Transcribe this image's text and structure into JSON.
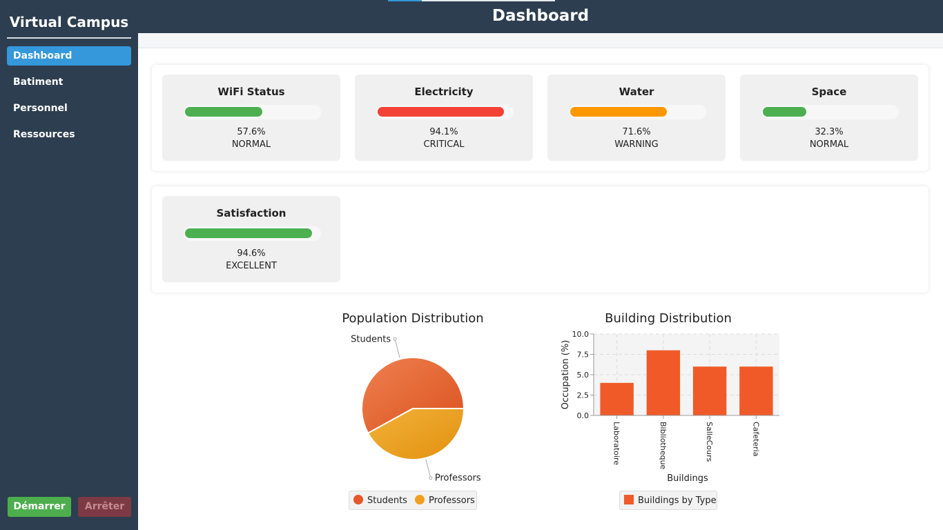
{
  "app": {
    "title": "Virtual Campus"
  },
  "header": {
    "title": "Dashboard"
  },
  "sidebar": {
    "items": [
      {
        "label": "Dashboard",
        "active": true
      },
      {
        "label": "Batiment",
        "active": false
      },
      {
        "label": "Personnel",
        "active": false
      },
      {
        "label": "Ressources",
        "active": false
      }
    ],
    "start_label": "Démarrer",
    "stop_label": "Arrêter"
  },
  "metrics": [
    {
      "title": "WiFi Status",
      "value_text": "57.6%",
      "status": "NORMAL",
      "level": 0.576,
      "color": "#4caf50"
    },
    {
      "title": "Electricity",
      "value_text": "94.1%",
      "status": "CRITICAL",
      "level": 0.941,
      "color": "#f44336"
    },
    {
      "title": "Water",
      "value_text": "71.6%",
      "status": "WARNING",
      "level": 0.716,
      "color": "#ff9800"
    },
    {
      "title": "Space",
      "value_text": "32.3%",
      "status": "NORMAL",
      "level": 0.323,
      "color": "#4caf50"
    },
    {
      "title": "Satisfaction",
      "value_text": "94.6%",
      "status": "EXCELLENT",
      "level": 0.946,
      "color": "#4caf50"
    }
  ],
  "colors": {
    "sidebar_bg": "#2d3e50",
    "accent": "#3498db",
    "start_button": "#4cae4c",
    "stop_button": "#7d3a44",
    "students": "#e8562c",
    "professors": "#f0a020",
    "bars": "#f05a28"
  },
  "chart_data": [
    {
      "type": "pie",
      "title": "Population Distribution",
      "slices": [
        {
          "label": "Students",
          "value": 58
        },
        {
          "label": "Professors",
          "value": 42
        }
      ],
      "legend": [
        "Students",
        "Professors"
      ],
      "legend_position": "bottom"
    },
    {
      "type": "bar",
      "title": "Building Distribution",
      "categories": [
        "Laboratoire",
        "Bibliotheque",
        "SalleCours",
        "Cafeteria"
      ],
      "values": [
        4.0,
        8.0,
        6.0,
        6.0
      ],
      "series": [
        {
          "name": "Buildings by Type",
          "values": [
            4.0,
            8.0,
            6.0,
            6.0
          ]
        }
      ],
      "xlabel": "Buildings",
      "ylabel": "Occupation (%)",
      "ylim": [
        0,
        10
      ],
      "yticks": [
        "0.0",
        "2.5",
        "5.0",
        "7.5",
        "10.0"
      ],
      "grid": true,
      "legend_position": "bottom"
    }
  ]
}
